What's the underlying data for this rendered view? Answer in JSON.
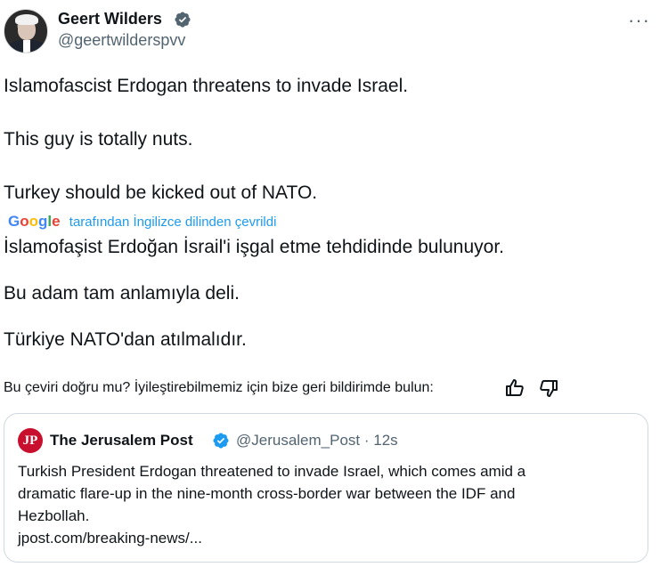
{
  "tweet": {
    "author_name": "Geert Wilders",
    "author_handle": "@geertwilderspvv",
    "more_label": "···",
    "lines": [
      "Islamofascist Erdogan threatens to invade Israel.",
      "This guy is totally nuts.",
      "Turkey should be kicked out of NATO."
    ]
  },
  "translation": {
    "provider": "Google",
    "attribution": "tarafından İngilizce dilinden çevrildi",
    "lines": [
      "İslamofaşist Erdoğan İsrail'i işgal etme tehdidinde bulunuyor.",
      "Bu adam tam anlamıyla deli.",
      "Türkiye NATO'dan atılmalıdır."
    ],
    "feedback_prompt": "Bu çeviri doğru mu? İyileştirebilmemiz için bize geri bildirimde bulun:"
  },
  "quoted_tweet": {
    "logo_text": "JP",
    "name": "The Jerusalem Post",
    "handle_time": "@Jerusalem_Post · 12s",
    "text_lines": [
      "Turkish President Erdogan threatened to invade Israel, which comes amid a",
      "dramatic flare-up in the nine-month cross-border war between the IDF and",
      "Hezbollah.",
      "jpost.com/breaking-news/..."
    ]
  },
  "icons": {
    "verified": "verified-badge-icon",
    "thumb_up": "thumb-up-icon",
    "thumb_down": "thumb-down-icon",
    "more": "more-options-icon"
  },
  "colors": {
    "accent": "#1d9bf0",
    "text_primary": "#0f1419",
    "text_secondary": "#536471",
    "border": "#cfd9de",
    "jp_red": "#c8102e"
  }
}
